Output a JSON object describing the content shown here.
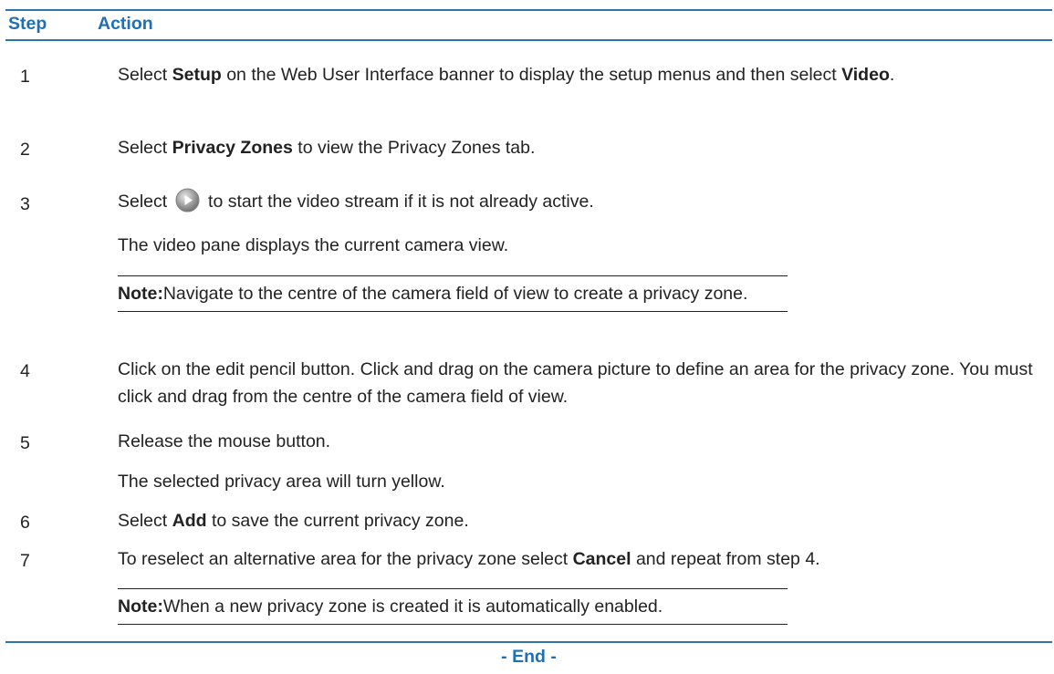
{
  "header": {
    "step_label": "Step",
    "action_label": "Action"
  },
  "steps": [
    {
      "num": "1",
      "parts": [
        "Select ",
        "Setup",
        " on the Web User Interface banner to display the setup menus and then select ",
        "Video",
        "."
      ]
    },
    {
      "num": "2",
      "parts": [
        "Select ",
        "Privacy Zones",
        " to view the Privacy Zones tab."
      ]
    },
    {
      "num": "3",
      "before_icon": "Select",
      "icon": "play-icon",
      "after_icon": "to start the video stream if it is not already active.",
      "followup": "The video pane displays the current camera view.",
      "note_label": "Note:",
      "note_text": "Navigate to the centre of the camera field of view to create a privacy zone."
    },
    {
      "num": "4",
      "text": "Click on the edit pencil button. Click and drag on the camera picture to define an area for the privacy zone. You must click and drag from the centre of the camera field of view."
    },
    {
      "num": "5",
      "text": "Release the mouse button.",
      "followup": "The selected privacy area will turn yellow."
    },
    {
      "num": "6",
      "parts": [
        "Select ",
        "Add",
        " to save the current privacy zone."
      ]
    },
    {
      "num": "7",
      "parts": [
        "To reselect an alternative area for the privacy zone select ",
        "Cancel",
        " and repeat from step 4."
      ],
      "note_label": "Note:",
      "note_text": "When a new privacy zone is created it is automatically enabled."
    }
  ],
  "footer": {
    "end_label": "- End -"
  },
  "colors": {
    "heading_blue": "#1f6fb2",
    "rule_blue": "#2e74a8",
    "text": "#222222"
  }
}
